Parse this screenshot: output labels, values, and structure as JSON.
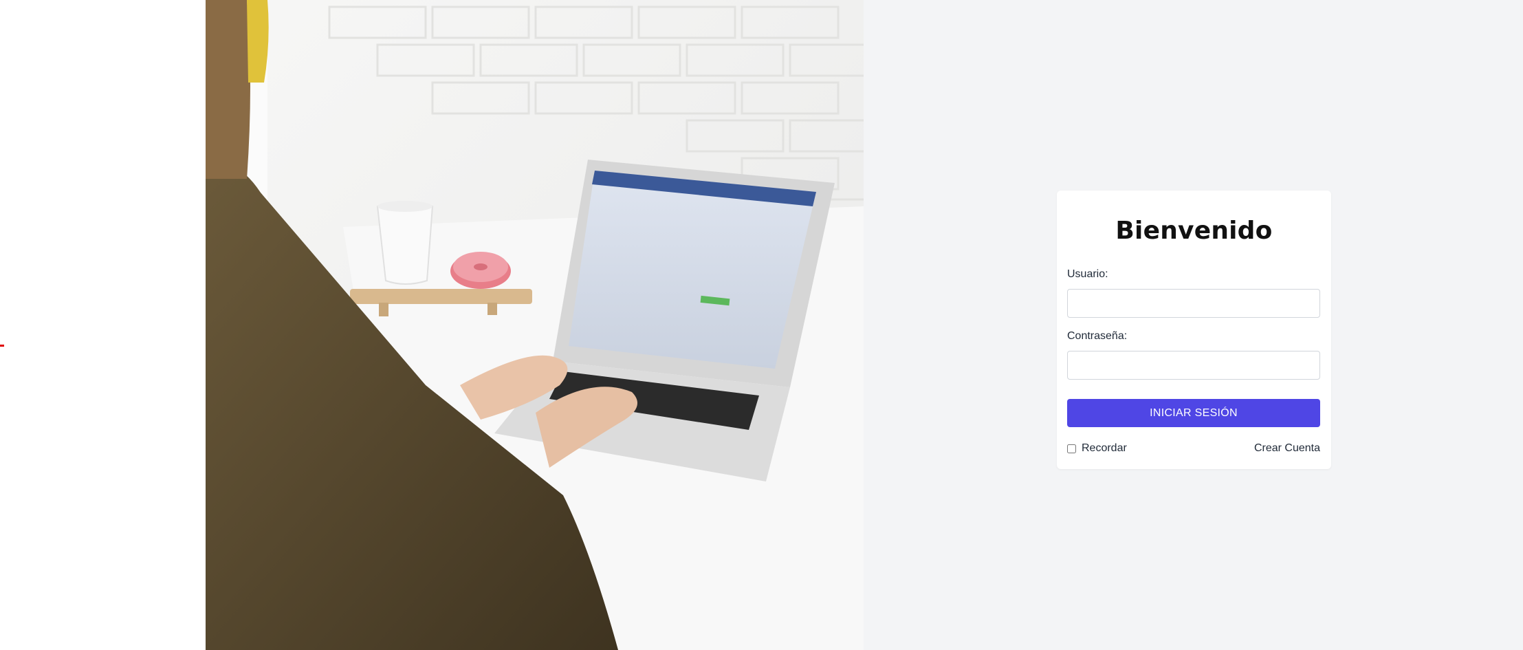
{
  "login": {
    "title": "Bienvenido",
    "username_label": "Usuario:",
    "username_value": "",
    "password_label": "Contraseña:",
    "password_value": "",
    "submit_label": "INICIAR SESIÓN",
    "remember_label": "Recordar",
    "remember_checked": false,
    "create_account_label": "Crear Cuenta"
  },
  "colors": {
    "accent": "#4f46e5",
    "panel_background": "#f3f4f6",
    "card_background": "#ffffff"
  }
}
